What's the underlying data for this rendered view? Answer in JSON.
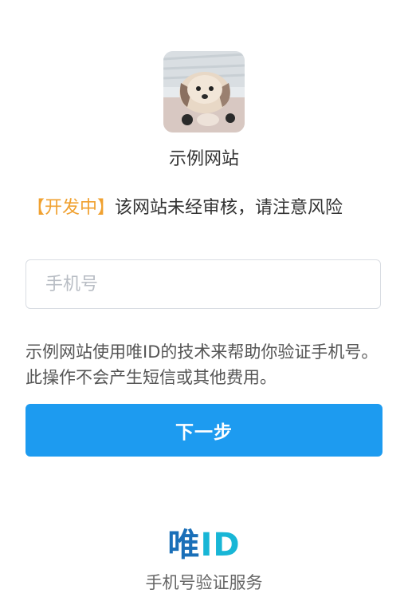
{
  "site": {
    "name": "示例网站",
    "avatar_icon": "dog-photo"
  },
  "warning": {
    "tag": "【开发中】",
    "message": "该网站未经审核，请注意风险",
    "tag_color": "#f0a130"
  },
  "phone": {
    "placeholder": "手机号",
    "value": ""
  },
  "notice": "示例网站使用唯ID的技术来帮助你验证手机号。此操作不会产生短信或其他费用。",
  "next_button": {
    "label": "下一步",
    "color": "#1d9bf0"
  },
  "brand": {
    "logo_part1": "唯",
    "logo_part2": "ID",
    "tagline": "手机号验证服务",
    "colors": [
      "#1a6fb8",
      "#18b6d6"
    ]
  }
}
